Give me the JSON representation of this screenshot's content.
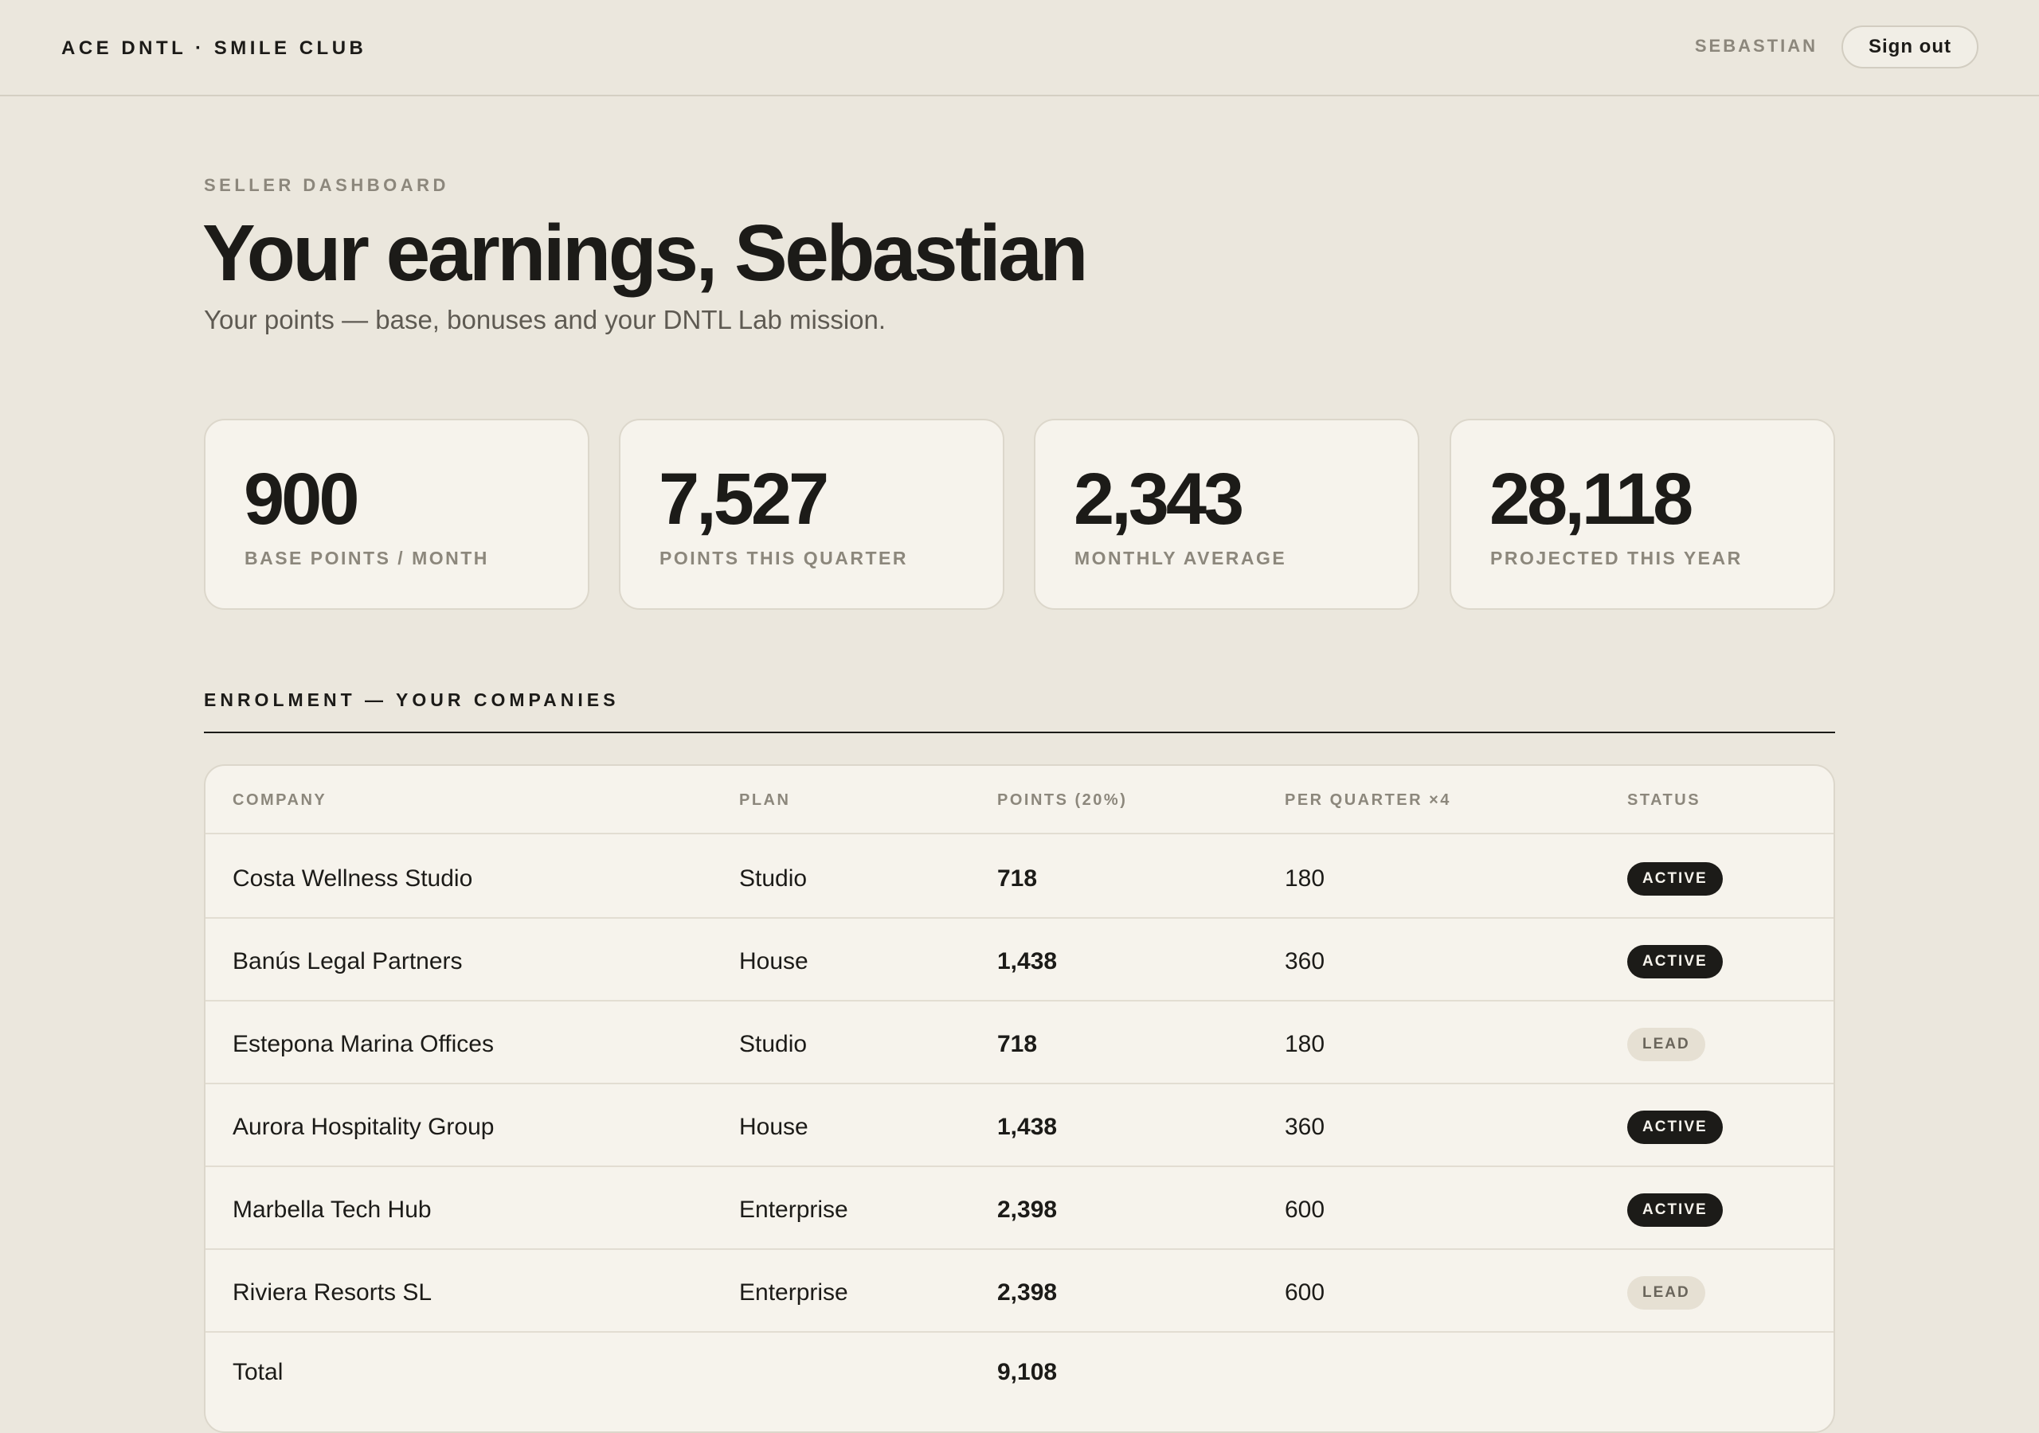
{
  "header": {
    "brand": "ACE DNTL · SMILE CLUB",
    "user": "SEBASTIAN",
    "signout_label": "Sign out"
  },
  "hero": {
    "eyebrow": "SELLER DASHBOARD",
    "title": "Your earnings, Sebastian",
    "subtitle": "Your points — base, bonuses and your DNTL Lab mission."
  },
  "stats": [
    {
      "value": "900",
      "label": "BASE POINTS / MONTH"
    },
    {
      "value": "7,527",
      "label": "POINTS THIS QUARTER"
    },
    {
      "value": "2,343",
      "label": "MONTHLY AVERAGE"
    },
    {
      "value": "28,118",
      "label": "PROJECTED THIS YEAR"
    }
  ],
  "section": {
    "title": "ENROLMENT — YOUR COMPANIES"
  },
  "table": {
    "columns": [
      "COMPANY",
      "PLAN",
      "POINTS (20%)",
      "PER QUARTER ×4",
      "STATUS"
    ],
    "rows": [
      {
        "company": "Costa Wellness Studio",
        "plan": "Studio",
        "points": "718",
        "per_quarter": "180",
        "status": "ACTIVE"
      },
      {
        "company": "Banús Legal Partners",
        "plan": "House",
        "points": "1,438",
        "per_quarter": "360",
        "status": "ACTIVE"
      },
      {
        "company": "Estepona Marina Offices",
        "plan": "Studio",
        "points": "718",
        "per_quarter": "180",
        "status": "LEAD"
      },
      {
        "company": "Aurora Hospitality Group",
        "plan": "House",
        "points": "1,438",
        "per_quarter": "360",
        "status": "ACTIVE"
      },
      {
        "company": "Marbella Tech Hub",
        "plan": "Enterprise",
        "points": "2,398",
        "per_quarter": "600",
        "status": "ACTIVE"
      },
      {
        "company": "Riviera Resorts SL",
        "plan": "Enterprise",
        "points": "2,398",
        "per_quarter": "600",
        "status": "LEAD"
      }
    ],
    "total": {
      "label": "Total",
      "points": "9,108"
    }
  }
}
